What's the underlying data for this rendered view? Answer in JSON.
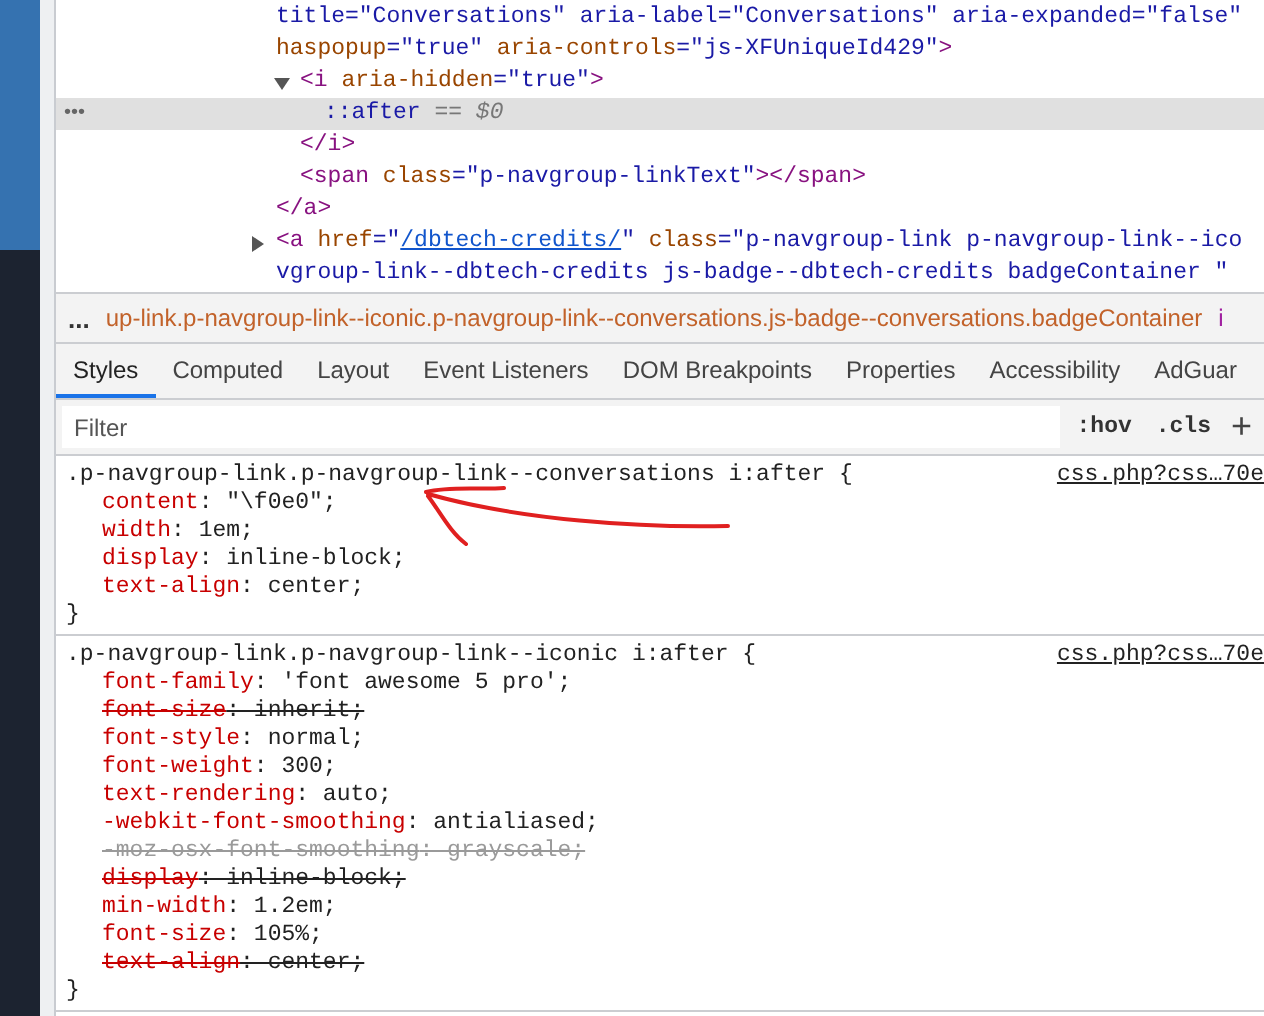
{
  "dom": [
    {
      "open": [
        [
          {
            "kind": "value",
            "text": "title=\"Conversations\" aria-label=\"Conversations\" aria-expanded=\"false\""
          }
        ],
        [
          {
            "kind": "attr",
            "text": "haspopup"
          },
          {
            "kind": "value",
            "text": "=\"true\""
          },
          {
            "kind": "attr",
            "text": " aria-controls"
          },
          {
            "kind": "value",
            "text": "=\"js-XFUniqueId429\""
          },
          {
            "kind": "tag",
            "text": ">"
          }
        ]
      ],
      "children": [
        {
          "open": [
            [
              {
                "kind": "tag",
                "text": "<i"
              },
              {
                "kind": "attr",
                "text": " aria-hidden"
              },
              {
                "kind": "value",
                "text": "=\"true\""
              },
              {
                "kind": "tag",
                "text": ">"
              }
            ]
          ],
          "expanded": true,
          "children": [
            {
              "open": [
                [
                  {
                    "kind": "pseudo",
                    "text": "::after"
                  },
                  {
                    "kind": "note",
                    "text": " == $0"
                  }
                ]
              ],
              "selected": true,
              "marker": "•••"
            }
          ],
          "close": [
            {
              "kind": "tag",
              "text": "</i>"
            }
          ]
        },
        {
          "open": [
            [
              {
                "kind": "tag",
                "text": "<span"
              },
              {
                "kind": "attr",
                "text": " class"
              },
              {
                "kind": "value",
                "text": "=\"p-navgroup-linkText\""
              },
              {
                "kind": "tag",
                "text": "></span>"
              }
            ]
          ]
        }
      ],
      "close": [
        {
          "kind": "tag",
          "text": "</a>"
        }
      ]
    },
    {
      "open": [
        [
          {
            "kind": "tag",
            "text": "<a"
          },
          {
            "kind": "attr",
            "text": " href"
          },
          {
            "kind": "value",
            "text": "=\""
          },
          {
            "kind": "link",
            "text": "/dbtech-credits/"
          },
          {
            "kind": "value",
            "text": "\""
          },
          {
            "kind": "attr",
            "text": " class"
          },
          {
            "kind": "value",
            "text": "=\"p-navgroup-link p-navgroup-link--ico"
          }
        ],
        [
          {
            "kind": "value",
            "text": "vgroup-link--dbtech-credits js-badge--dbtech-credits badgeContainer \""
          }
        ]
      ],
      "expanded": false
    }
  ],
  "breadcrumb": {
    "more": "...",
    "path": "up-link.p-navgroup-link--iconic.p-navgroup-link--conversations.js-badge--conversations.badgeContainer",
    "next": "i"
  },
  "tabs": [
    {
      "label": "Styles",
      "selected": true
    },
    {
      "label": "Computed",
      "selected": false
    },
    {
      "label": "Layout",
      "selected": false
    },
    {
      "label": "Event Listeners",
      "selected": false
    },
    {
      "label": "DOM Breakpoints",
      "selected": false
    },
    {
      "label": "Properties",
      "selected": false
    },
    {
      "label": "Accessibility",
      "selected": false
    },
    {
      "label": "AdGuar",
      "selected": false
    }
  ],
  "filter": {
    "placeholder": "Filter",
    "buttons": [
      ":hov",
      ".cls",
      "+"
    ]
  },
  "rules": [
    {
      "selector": ".p-navgroup-link.p-navgroup-link--conversations i:after {",
      "source": "css.php?css…70e",
      "annotated": true,
      "declarations": [
        {
          "property": "content",
          "value": ": \"\\f0e0\";",
          "kind": "active"
        },
        {
          "property": "width",
          "value": ": 1em;",
          "kind": "active"
        },
        {
          "property": "display",
          "value": ": inline-block;",
          "kind": "active"
        },
        {
          "property": "text-align",
          "value": ": center;",
          "kind": "active"
        }
      ],
      "end": "}"
    },
    {
      "selector": ".p-navgroup-link.p-navgroup-link--iconic i:after {",
      "source": "css.php?css…70e",
      "annotated": false,
      "declarations": [
        {
          "property": "font-family",
          "value": ": 'font awesome 5 pro';",
          "kind": "active"
        },
        {
          "property": "font-size",
          "value": ": inherit;",
          "kind": "overridden"
        },
        {
          "property": "font-style",
          "value": ": normal;",
          "kind": "active"
        },
        {
          "property": "font-weight",
          "value": ": 300;",
          "kind": "active"
        },
        {
          "property": "text-rendering",
          "value": ": auto;",
          "kind": "active"
        },
        {
          "property": "-webkit-font-smoothing",
          "value": ": antialiased;",
          "kind": "active"
        },
        {
          "property": "-moz-osx-font-smoothing",
          "value": ": grayscale;",
          "kind": "invalid"
        },
        {
          "property": "display",
          "value": ": inline-block;",
          "kind": "overridden"
        },
        {
          "property": "min-width",
          "value": ": 1.2em;",
          "kind": "active"
        },
        {
          "property": "font-size",
          "value": ": 105%;",
          "kind": "active"
        },
        {
          "property": "text-align",
          "value": ": center;",
          "kind": "overridden"
        }
      ],
      "end": "}"
    }
  ]
}
